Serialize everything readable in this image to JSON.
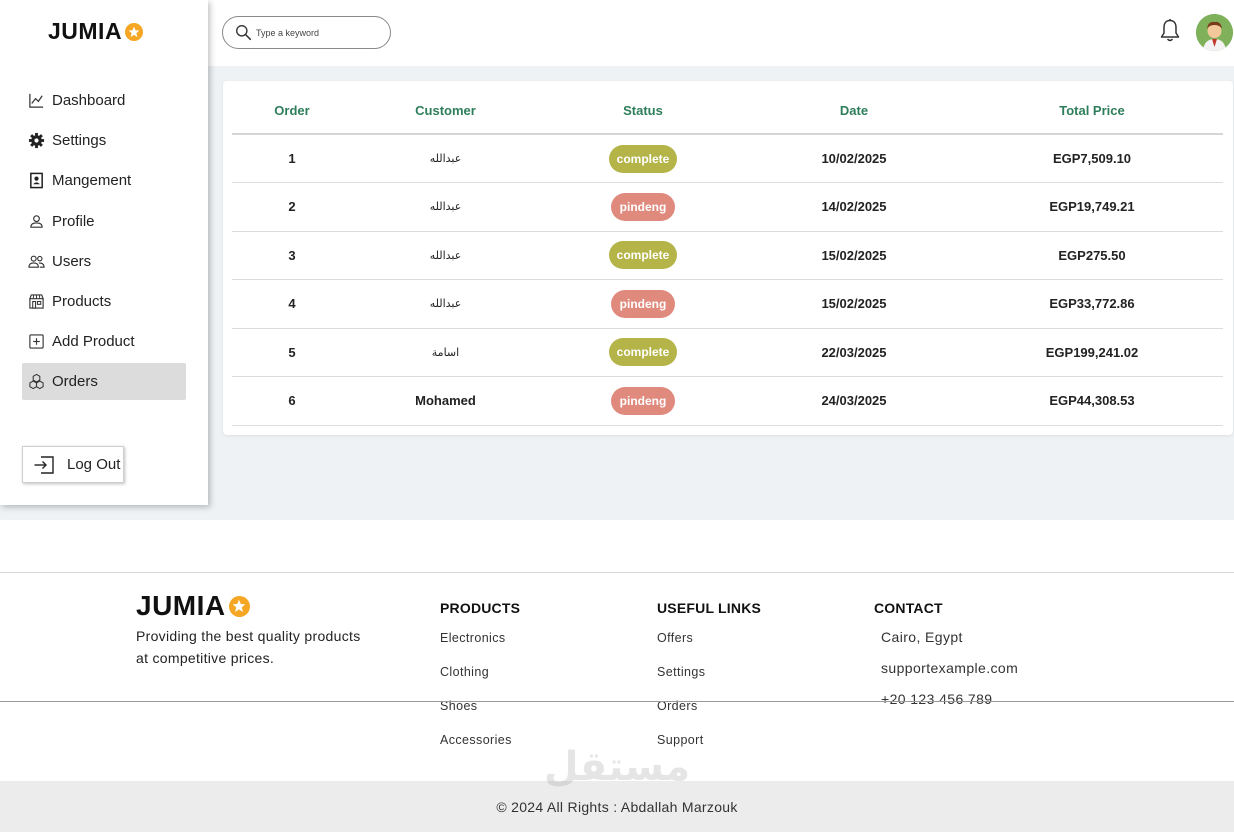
{
  "brand": {
    "name": "JUMIA",
    "accent": "#f5a623",
    "active_bg": "#dcdcdc",
    "header_green": "#2e7d5b"
  },
  "search": {
    "placeholder": "Type a keyword"
  },
  "sidebar": {
    "items": [
      {
        "label": "Dashboard",
        "icon": "chart-line-icon"
      },
      {
        "label": "Settings",
        "icon": "gear-icon"
      },
      {
        "label": "Mangement",
        "icon": "id-badge-icon"
      },
      {
        "label": "Profile",
        "icon": "user-icon"
      },
      {
        "label": "Users",
        "icon": "users-icon"
      },
      {
        "label": "Products",
        "icon": "store-icon"
      },
      {
        "label": "Add Product",
        "icon": "plus-square-icon"
      },
      {
        "label": "Orders",
        "icon": "boxes-icon",
        "active": true
      }
    ],
    "logout_label": "Log Out"
  },
  "orders_table": {
    "columns": [
      "Order",
      "Customer",
      "Status",
      "Date",
      "Total Price"
    ],
    "rows": [
      {
        "order": "1",
        "customer": "عبدالله",
        "status": "complete",
        "date": "10/02/2025",
        "total": "EGP7,509.10"
      },
      {
        "order": "2",
        "customer": "عبدالله",
        "status": "pindeng",
        "date": "14/02/2025",
        "total": "EGP19,749.21"
      },
      {
        "order": "3",
        "customer": "عبدالله",
        "status": "complete",
        "date": "15/02/2025",
        "total": "EGP275.50"
      },
      {
        "order": "4",
        "customer": "عبدالله",
        "status": "pindeng",
        "date": "15/02/2025",
        "total": "EGP33,772.86"
      },
      {
        "order": "5",
        "customer": "اسامة",
        "status": "complete",
        "date": "22/03/2025",
        "total": "EGP199,241.02"
      },
      {
        "order": "6",
        "customer": "Mohamed",
        "status": "pindeng",
        "date": "24/03/2025",
        "total": "EGP44,308.53"
      }
    ],
    "status_colors": {
      "complete": "#b4b448",
      "pindeng": "#e08a7e"
    }
  },
  "footer": {
    "brand": "JUMIA",
    "tagline": "Providing the best quality products at competitive prices.",
    "products": {
      "title": "PRODUCTS",
      "links": [
        "Electronics",
        "Clothing",
        "Shoes",
        "Accessories"
      ]
    },
    "useful_links": {
      "title": "USEFUL LINKS",
      "links": [
        "Offers",
        "Settings",
        "Orders",
        "Support"
      ]
    },
    "contact": {
      "title": "CONTACT",
      "items": [
        "Cairo, Egypt",
        "supportexample.com",
        "+20 123 456 789"
      ]
    },
    "copyright": "© 2024 All Rights : Abdallah Marzouk",
    "watermark": "مستقل"
  }
}
